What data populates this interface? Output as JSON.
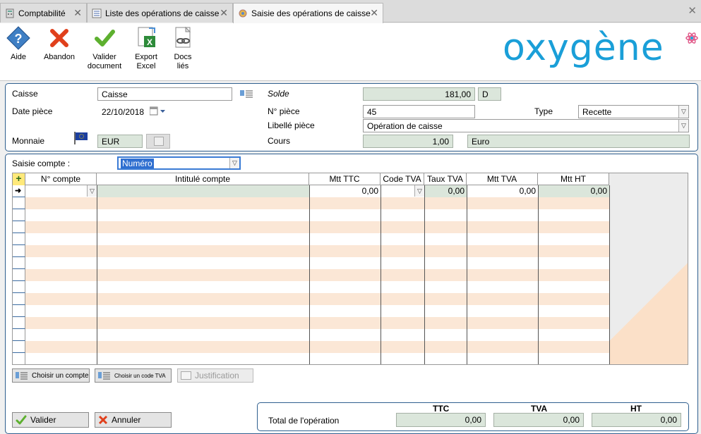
{
  "tabs": [
    {
      "label": "Comptabilité",
      "icon": "calculator-icon"
    },
    {
      "label": "Liste des opérations de caisse",
      "icon": "list-icon"
    },
    {
      "label": "Saisie des opérations de caisse",
      "icon": "gears-icon"
    }
  ],
  "toolbar": {
    "aide": "Aide",
    "abandon": "Abandon",
    "valider_l1": "Valider",
    "valider_l2": "document",
    "export_l1": "Export",
    "export_l2": "Excel",
    "docs_l1": "Docs",
    "docs_l2": "liés"
  },
  "logo": "oxygène",
  "form": {
    "caisse_label": "Caisse",
    "caisse_value": "Caisse",
    "date_label": "Date pièce",
    "date_value": "22/10/2018",
    "monnaie_label": "Monnaie",
    "monnaie_value": "EUR",
    "solde_label": "Solde",
    "solde_value": "181,00",
    "solde_sens": "D",
    "npiece_label": "N° pièce",
    "npiece_value": "45",
    "type_label": "Type",
    "type_value": "Recette",
    "libelle_label": "Libellé pièce",
    "libelle_value": "Opération de caisse",
    "cours_label": "Cours",
    "cours_value": "1,00",
    "cours_devise": "Euro"
  },
  "saisie": {
    "label": "Saisie compte :",
    "value": "Numéro"
  },
  "grid": {
    "columns": [
      "N° compte",
      "Intitulé compte",
      "Mtt TTC",
      "Code TVA",
      "Taux TVA",
      "Mtt TVA",
      "Mtt HT"
    ],
    "first_row": {
      "mtt_ttc": "0,00",
      "taux_tva": "0,00",
      "mtt_tva": "0,00",
      "mtt_ht": "0,00"
    }
  },
  "buttons": {
    "choisir_compte": "Choisir un compte",
    "choisir_tva": "Choisir un code TVA",
    "justification": "Justification",
    "valider": "Valider",
    "annuler": "Annuler"
  },
  "totals": {
    "label": "Total de l'opération",
    "ttc_label": "TTC",
    "tva_label": "TVA",
    "ht_label": "HT",
    "ttc": "0,00",
    "tva": "0,00",
    "ht": "0,00"
  },
  "colors": {
    "accent": "#1a9fd8",
    "row_alt": "#fbe7d6",
    "readonly": "#dbe6db",
    "panel_border": "#2f5f8f"
  }
}
